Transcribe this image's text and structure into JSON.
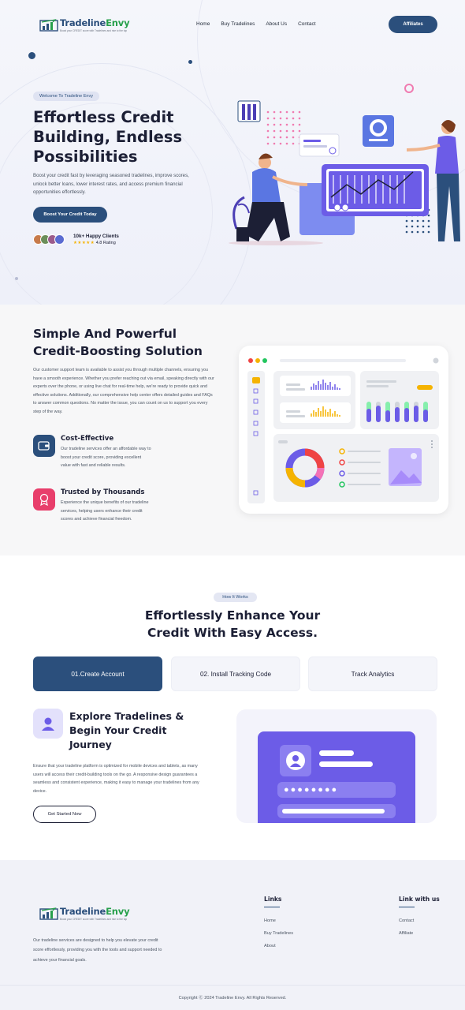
{
  "brand": {
    "name_part1": "Tradeline",
    "name_part2": "Envy",
    "tagline": "Boost your CREDIT score with Tradelines and rise to the top",
    "primary_color": "#2b4f7c",
    "accent_color": "#27a04b"
  },
  "nav": {
    "items": [
      "Home",
      "Buy Tradelines",
      "About Us",
      "Contact"
    ],
    "cta": "Affiliates"
  },
  "hero": {
    "pill": "Welcome To Tradeline Envy",
    "title": "Effortless Credit Building, Endless Possibilities",
    "description": "Boost your credit fast by leveraging seasoned tradelines, improve scores, unlock better loans, lower interest rates, and access premium financial opportunities effortlessly.",
    "button": "Boost Your Credit Today",
    "happy_clients": "10k+ Happy Clients",
    "stars": "★★★★★",
    "rating": "4.8 Rating"
  },
  "solution": {
    "title": "Simple And Powerful Credit-Boosting Solution",
    "description": "Our customer support team is available to assist you through multiple channels, ensuring you have a smooth experience. Whether you prefer reaching out via email, speaking directly with our experts over the phone, or using live chat for real-time help, we're ready to provide quick and effective solutions. Additionally, our comprehensive help center offers detailed guides and FAQs to answer common questions. No matter the issue, you can count on us to support you every step of the way.",
    "features": [
      {
        "title": "Cost-Effective",
        "description": "Our tradeline services offer an affordable way to boost your credit score, providing excellent value with fast and reliable results.",
        "icon": "wallet-icon"
      },
      {
        "title": "Trusted by Thousands",
        "description": "Experience the unique benefits of our tradeline services, helping users enhance their credit scores and achieve financial freedom.",
        "icon": "award-icon"
      }
    ]
  },
  "how": {
    "pill": "How It Works",
    "title": "Effortlessly Enhance Your Credit With Easy Access.",
    "tabs": [
      "01.Create Account",
      "02. Install Tracking Code",
      "Track Analytics"
    ],
    "active_tab": 0,
    "explore_title": "Explore Tradelines & Begin Your Credit Journey",
    "explore_desc": "Ensure that your tradeline platform is optimized for mobile devices and tablets, as many users will access their credit-building tools on the go. A responsive design guarantees a seamless and consistent experience, making it easy to manage your tradelines from any device.",
    "button": "Get Started Now",
    "password_mask": "●●●●●●●●"
  },
  "footer": {
    "description": "Our tradeline services are designed to help you elevate your credit score effortlessly, providing you with the tools and support needed to achieve your financial goals.",
    "links_title": "Links",
    "links": [
      "Home",
      "Buy Tradelines",
      "About"
    ],
    "connect_title": "Link with us",
    "connect": [
      "Contact",
      "Affiliate"
    ],
    "copyright": "Copyright Ⓒ 2024 Tradeline Envy. All Rights Reserved."
  }
}
